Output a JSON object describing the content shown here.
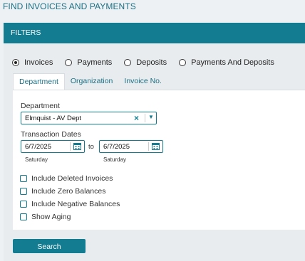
{
  "page_title": "FIND INVOICES AND PAYMENTS",
  "filters": {
    "header": "FILTERS",
    "radios": [
      {
        "label": "Invoices",
        "selected": true
      },
      {
        "label": "Payments",
        "selected": false
      },
      {
        "label": "Deposits",
        "selected": false
      },
      {
        "label": "Payments And Deposits",
        "selected": false
      }
    ],
    "tabs": [
      {
        "label": "Department",
        "active": true
      },
      {
        "label": "Organization",
        "active": false
      },
      {
        "label": "Invoice No.",
        "active": false
      }
    ],
    "department": {
      "label": "Department",
      "value": "Elmquist - AV Dept",
      "clear_icon": "close-icon",
      "dropdown_icon": "chevron-down-icon"
    },
    "transaction_dates": {
      "label": "Transaction Dates",
      "from": {
        "value": "6/7/2025",
        "day": "Saturday"
      },
      "to_label": "to",
      "to": {
        "value": "6/7/2025",
        "day": "Saturday"
      },
      "calendar_icon": "calendar-icon"
    },
    "checkboxes": [
      {
        "label": "Include Deleted Invoices",
        "checked": false
      },
      {
        "label": "Include Zero Balances",
        "checked": false
      },
      {
        "label": "Include Negative Balances",
        "checked": false
      },
      {
        "label": "Show Aging",
        "checked": false
      }
    ]
  },
  "search_button": "Search",
  "colors": {
    "accent": "#137c91",
    "background": "#eef1f4",
    "panel": "#ffffff"
  }
}
